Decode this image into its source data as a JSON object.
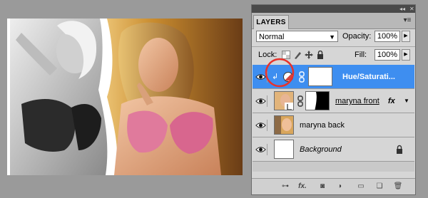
{
  "panel": {
    "tab_label": "LAYERS",
    "menu_icon": "panel-menu-icon",
    "blend_mode": "Normal",
    "opacity_label": "Opacity:",
    "opacity_value": "100%",
    "lock_label": "Lock:",
    "fill_label": "Fill:",
    "fill_value": "100%"
  },
  "layers": [
    {
      "name": "Hue/Saturati...",
      "selected": true,
      "italic": false
    },
    {
      "name": "maryna front",
      "selected": false,
      "fx": "fx"
    },
    {
      "name": "maryna back",
      "selected": false
    },
    {
      "name": "Background",
      "selected": false,
      "italic": true
    }
  ],
  "colors": {
    "selection": "#3e8ef0",
    "annotation_circle": "#e8322b",
    "panel_bg": "#d6d6d6"
  },
  "footer_icons": [
    "link-icon",
    "fx-icon",
    "mask-icon",
    "adjustment-icon",
    "group-icon",
    "new-layer-icon",
    "trash-icon"
  ]
}
